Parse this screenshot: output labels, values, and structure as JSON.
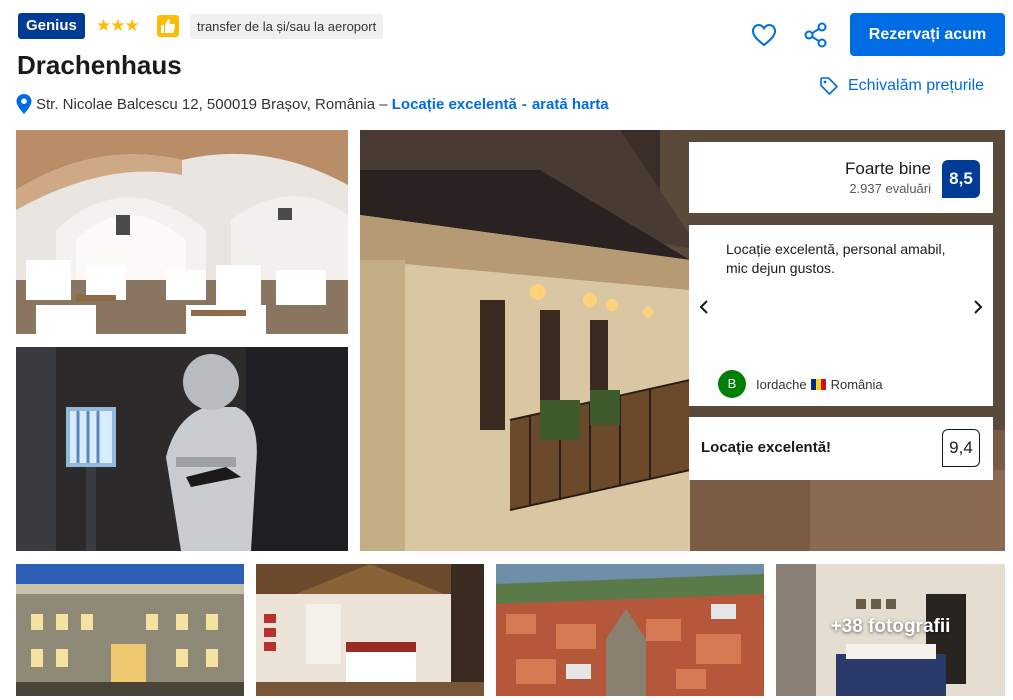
{
  "header": {
    "genius_badge": "Genius",
    "stars": "★★★",
    "transfer_tag": "transfer de la și/sau la aeroport",
    "hotel_name": "Drachenhaus",
    "address": "Str. Nicolae Balcescu 12, 500019 Brașov, România –",
    "location_link": "Locație excelentă",
    "location_sep": "-",
    "map_link": "arată harta",
    "reserve_button": "Rezervați acum",
    "price_match": "Echivalăm prețurile"
  },
  "reviews": {
    "score_label": "Foarte bine",
    "review_count": "2.937 evaluări",
    "score": "8,5",
    "featured_review": "Locație excelentă, personal amabil, mic dejun gustos.",
    "reviewer_initial": "B",
    "reviewer_name": "Iordache",
    "reviewer_country": "România",
    "location_label": "Locație excelentă!",
    "location_score": "9,4"
  },
  "gallery": {
    "more_photos": "+38 fotografii"
  },
  "colors": {
    "brand_blue": "#003b95",
    "link_blue": "#006ce4",
    "star_yellow": "#febb02",
    "avatar_green": "#008009"
  }
}
